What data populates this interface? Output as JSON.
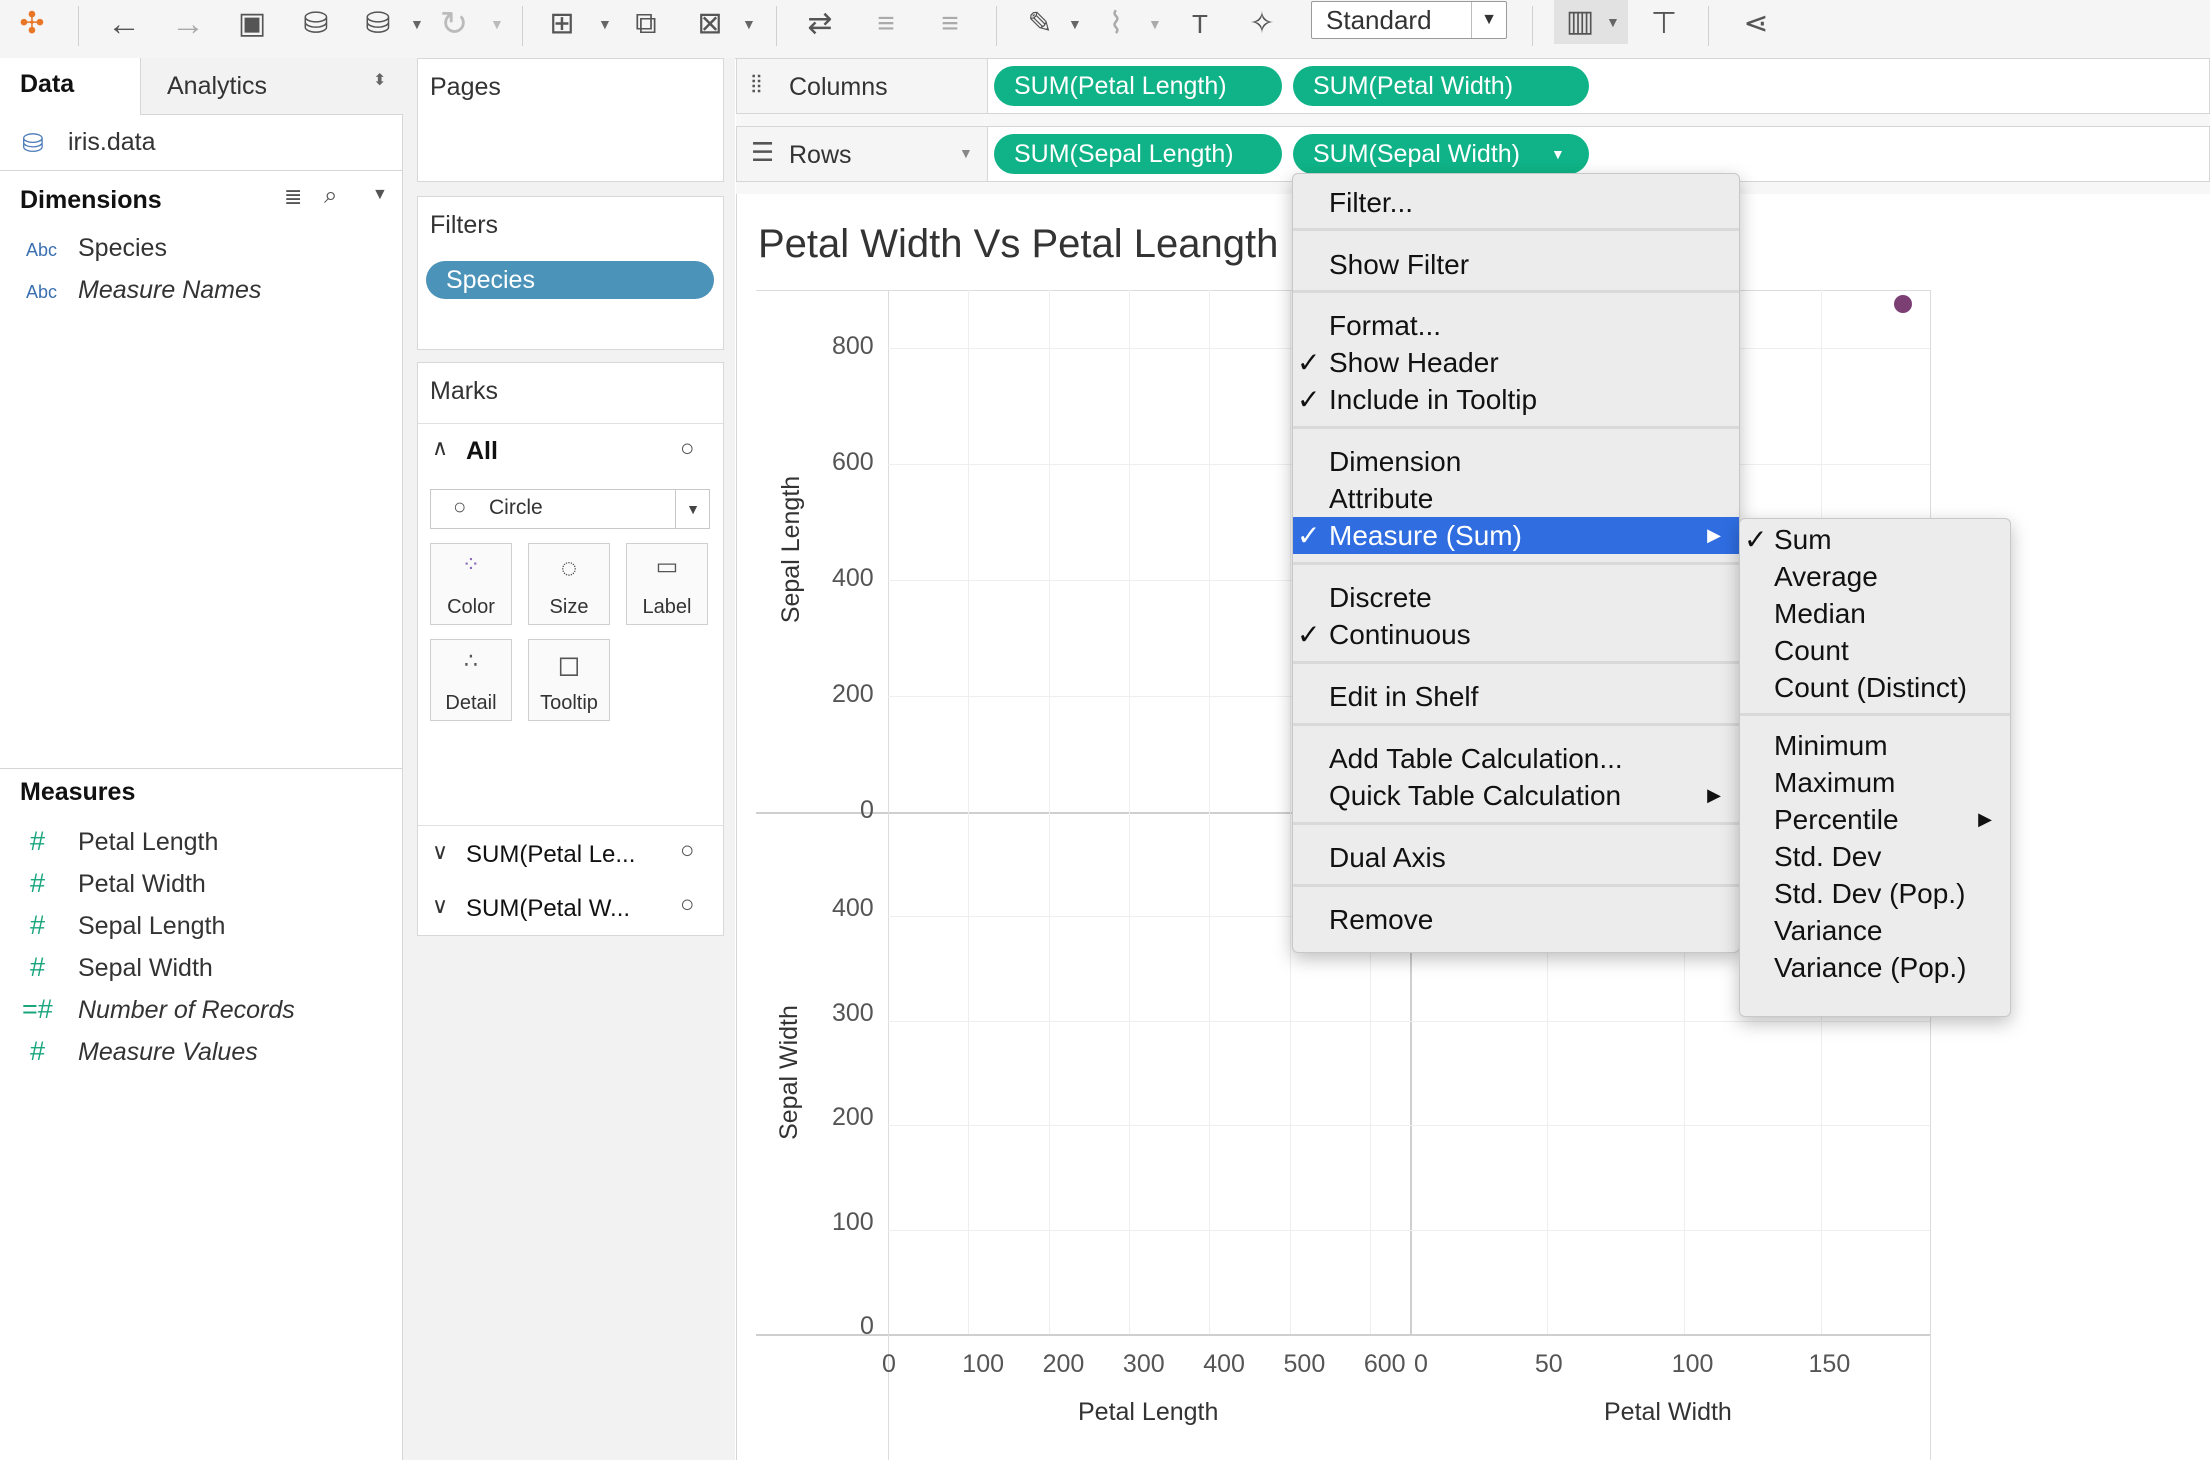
{
  "toolbar": {
    "standard_select": "Standard",
    "icons": [
      "tableau-logo-icon",
      "back-icon",
      "forward-icon",
      "save-icon",
      "new-datasource-icon",
      "pause-updates-icon",
      "refresh-icon",
      "new-worksheet-icon",
      "duplicate-sheet-icon",
      "clear-sheet-icon",
      "swap-axes-icon",
      "sort-ascending-icon",
      "sort-descending-icon",
      "highlight-icon",
      "group-icon",
      "label-icon",
      "pin-icon",
      "show-me-icon",
      "presentation-icon",
      "share-icon"
    ]
  },
  "data_pane": {
    "tab_data": "Data",
    "tab_analytics": "Analytics",
    "datasource": "iris.data",
    "dimensions_header": "Dimensions",
    "dimensions": [
      {
        "type": "Abc",
        "name": "Species",
        "italic": false
      },
      {
        "type": "Abc",
        "name": "Measure Names",
        "italic": true
      }
    ],
    "measures_header": "Measures",
    "measures": [
      {
        "type": "#",
        "name": "Petal Length",
        "italic": false
      },
      {
        "type": "#",
        "name": "Petal Width",
        "italic": false
      },
      {
        "type": "#",
        "name": "Sepal Length",
        "italic": false
      },
      {
        "type": "#",
        "name": "Sepal Width",
        "italic": false
      },
      {
        "type": "=#",
        "name": "Number of Records",
        "italic": true
      },
      {
        "type": "#",
        "name": "Measure Values",
        "italic": true
      }
    ]
  },
  "cards": {
    "pages": "Pages",
    "filters": "Filters",
    "filter_pill": "Species",
    "marks": "Marks",
    "marks_all": "All",
    "mark_type": "Circle",
    "mark_buttons": [
      "Color",
      "Size",
      "Label",
      "Detail",
      "Tooltip"
    ],
    "mark_subsections": [
      "SUM(Petal Le...",
      "SUM(Petal W..."
    ]
  },
  "shelves": {
    "columns_label": "Columns",
    "rows_label": "Rows",
    "columns_pills": [
      "SUM(Petal Length)",
      "SUM(Petal Width)"
    ],
    "rows_pills": [
      "SUM(Sepal Length)",
      "SUM(Sepal Width)"
    ]
  },
  "chart_data": {
    "type": "scatter",
    "title": "Petal Width Vs Petal Leangth",
    "panes": [
      {
        "x_field": "Petal Length",
        "y_field": "Sepal Length",
        "xlim": [
          0,
          650
        ],
        "ylim": [
          0,
          900
        ]
      },
      {
        "x_field": "Petal Width",
        "y_field": "Sepal Length",
        "xlim": [
          0,
          190
        ],
        "ylim": [
          0,
          900
        ],
        "points": [
          {
            "x": 180,
            "y": 876
          }
        ]
      },
      {
        "x_field": "Petal Length",
        "y_field": "Sepal Width",
        "xlim": [
          0,
          650
        ],
        "ylim": [
          0,
          500
        ]
      },
      {
        "x_field": "Petal Width",
        "y_field": "Sepal Width",
        "xlim": [
          0,
          190
        ],
        "ylim": [
          0,
          500
        ]
      }
    ],
    "y_axis_top_title": "Sepal Length",
    "y_axis_top_ticks": [
      "800",
      "600",
      "400",
      "200",
      "0"
    ],
    "y_axis_bottom_title": "Sepal Width",
    "y_axis_bottom_ticks": [
      "400",
      "300",
      "200",
      "100",
      "0"
    ],
    "x_axis_left_title": "Petal Length",
    "x_axis_left_ticks": [
      "0",
      "100",
      "200",
      "300",
      "400",
      "500",
      "600"
    ],
    "x_axis_right_title": "Petal Width",
    "x_axis_right_ticks": [
      "0",
      "50",
      "100",
      "150"
    ],
    "point_color": "#7b3f74"
  },
  "context_menu": {
    "items": [
      {
        "label": "Filter...",
        "checked": false
      },
      {
        "label": "Show Filter",
        "checked": false
      },
      {
        "label": "Format...",
        "checked": false
      },
      {
        "label": "Show Header",
        "checked": true
      },
      {
        "label": "Include in Tooltip",
        "checked": true
      },
      {
        "label": "Dimension",
        "checked": false
      },
      {
        "label": "Attribute",
        "checked": false
      },
      {
        "label": "Measure (Sum)",
        "checked": true,
        "highlighted": true,
        "submenu": true
      },
      {
        "label": "Discrete",
        "checked": false
      },
      {
        "label": "Continuous",
        "checked": true
      },
      {
        "label": "Edit in Shelf",
        "checked": false
      },
      {
        "label": "Add Table Calculation...",
        "checked": false
      },
      {
        "label": "Quick Table Calculation",
        "checked": false,
        "submenu": true
      },
      {
        "label": "Dual Axis",
        "checked": false
      },
      {
        "label": "Remove",
        "checked": false
      }
    ]
  },
  "submenu": {
    "items": [
      {
        "label": "Sum",
        "checked": true
      },
      {
        "label": "Average"
      },
      {
        "label": "Median"
      },
      {
        "label": "Count"
      },
      {
        "label": "Count (Distinct)"
      },
      {
        "label": "Minimum"
      },
      {
        "label": "Maximum"
      },
      {
        "label": "Percentile",
        "submenu": true
      },
      {
        "label": "Std. Dev"
      },
      {
        "label": "Std. Dev (Pop.)"
      },
      {
        "label": "Variance"
      },
      {
        "label": "Variance (Pop.)"
      }
    ]
  }
}
